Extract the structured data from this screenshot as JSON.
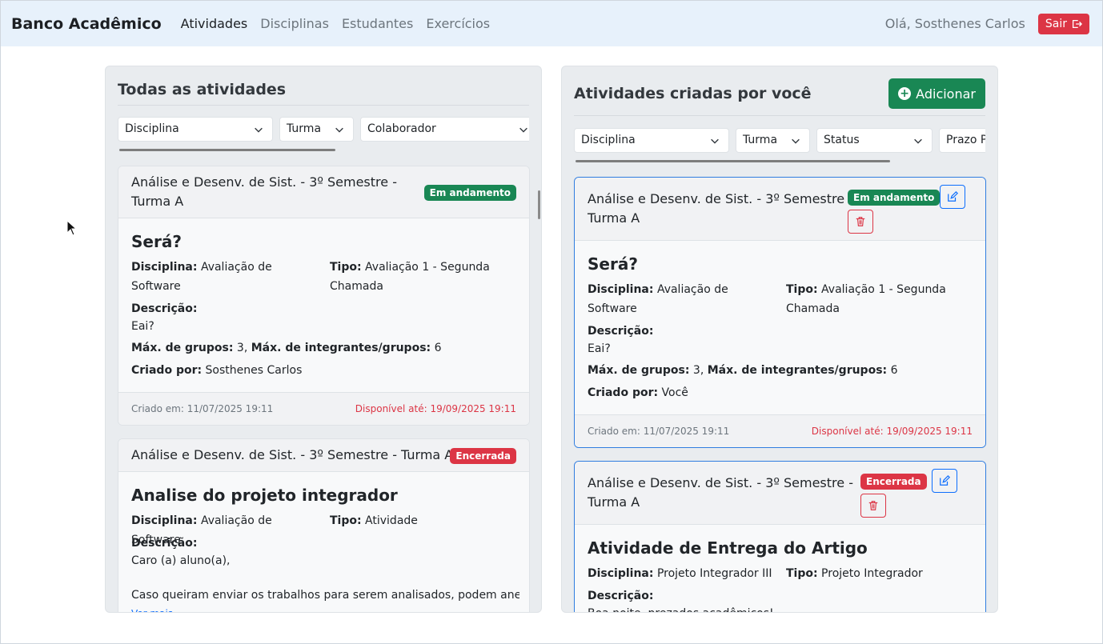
{
  "navbar": {
    "brand": "Banco Acadêmico",
    "links": [
      "Atividades",
      "Disciplinas",
      "Estudantes",
      "Exercícios"
    ],
    "greeting": "Olá, Sosthenes Carlos",
    "logout_label": "Sair"
  },
  "left_panel": {
    "title": "Todas as atividades",
    "filters": [
      "Disciplina",
      "Turma",
      "Colaborador"
    ],
    "cards": [
      {
        "class_name": "Análise e Desenv. de Sist. - 3º Semestre - Turma A",
        "status": "Em andamento",
        "title": "Será?",
        "discipline_label": "Disciplina:",
        "discipline": "Avaliação de Software",
        "type_label": "Tipo:",
        "type": "Avaliação 1 - Segunda Chamada",
        "description_label": "Descrição:",
        "description": "Eai?",
        "max_groups_label": "Máx. de grupos:",
        "max_groups": "3",
        "max_members_label": "Máx. de integrantes/grupos:",
        "max_members": "6",
        "created_by_label": "Criado por:",
        "created_by": "Sosthenes Carlos",
        "created_at": "Criado em: 11/07/2025 19:11",
        "available_until": "Disponível até: 19/09/2025 19:11"
      },
      {
        "class_name": "Análise e Desenv. de Sist. - 3º Semestre - Turma A",
        "status": "Encerrada",
        "title": "Analise do projeto integrador",
        "discipline_label": "Disciplina:",
        "discipline": "Avaliação de Software",
        "type_label": "Tipo:",
        "type": "Atividade",
        "description_label": "Descrição:",
        "description_line1": "Caro (a) aluno(a),",
        "description_line2": "Caso queiram enviar os trabalhos para serem analisados, podem anex...",
        "see_more": "Ver mais"
      }
    ]
  },
  "right_panel": {
    "title": "Atividades criadas por você",
    "add_label": "Adicionar",
    "filters": [
      "Disciplina",
      "Turma",
      "Status",
      "Prazo P"
    ],
    "cards": [
      {
        "class_name_line1": "Análise e Desenv. de Sist. - 3º Semestre -",
        "class_name_line2": "Turma A",
        "status": "Em andamento",
        "title": "Será?",
        "discipline_label": "Disciplina:",
        "discipline": "Avaliação de Software",
        "type_label": "Tipo:",
        "type": "Avaliação 1 - Segunda Chamada",
        "description_label": "Descrição:",
        "description": "Eai?",
        "max_groups_label": "Máx. de grupos:",
        "max_groups": "3",
        "max_members_label": "Máx. de integrantes/grupos:",
        "max_members": "6",
        "created_by_label": "Criado por:",
        "created_by": "Você",
        "created_at": "Criado em: 11/07/2025 19:11",
        "available_until": "Disponível até: 19/09/2025 19:11"
      },
      {
        "class_name_line1": "Análise e Desenv. de Sist. - 3º Semestre -",
        "class_name_line2": "Turma A",
        "status": "Encerrada",
        "title": "Atividade de Entrega do Artigo",
        "discipline_label": "Disciplina:",
        "discipline": "Projeto Integrador III",
        "type_label": "Tipo:",
        "type": "Projeto Integrador",
        "description_label": "Descrição:",
        "description": "Boa noite, prezados acadêmicos!"
      }
    ]
  },
  "colors": {
    "navbar_bg": "#e7f1fb",
    "success": "#198754",
    "danger": "#dc3545",
    "primary": "#0d6efd"
  },
  "icons": [
    "logout-icon",
    "chevron-down-icon",
    "plus-circle-icon",
    "edit-icon",
    "trash-icon",
    "mouse-cursor-icon"
  ]
}
